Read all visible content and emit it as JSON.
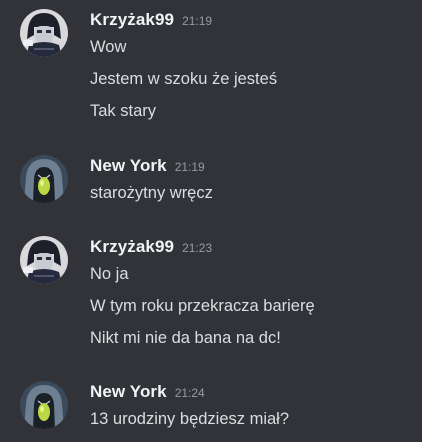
{
  "messages": [
    {
      "author": "Krzyżak99",
      "time": "21:19",
      "avatar_icon": "anime-character-avatar-icon",
      "lines": [
        "Wow",
        "Jestem w szoku że jesteś",
        "Tak stary"
      ]
    },
    {
      "author": "New York",
      "time": "21:19",
      "avatar_icon": "hooded-figure-avatar-icon",
      "lines": [
        "starożytny wręcz"
      ]
    },
    {
      "author": "Krzyżak99",
      "time": "21:23",
      "avatar_icon": "anime-character-avatar-icon",
      "lines": [
        "No ja",
        "W tym roku przekracza barierę",
        "Nikt mi nie da bana na dc!"
      ]
    },
    {
      "author": "New York",
      "time": "21:24",
      "avatar_icon": "hooded-figure-avatar-icon",
      "lines": [
        "13 urodziny będziesz miał?"
      ]
    }
  ],
  "colors": {
    "background": "#313338",
    "username": "#f2f3f5",
    "message_text": "#dbdee1",
    "timestamp": "#949ba4"
  }
}
